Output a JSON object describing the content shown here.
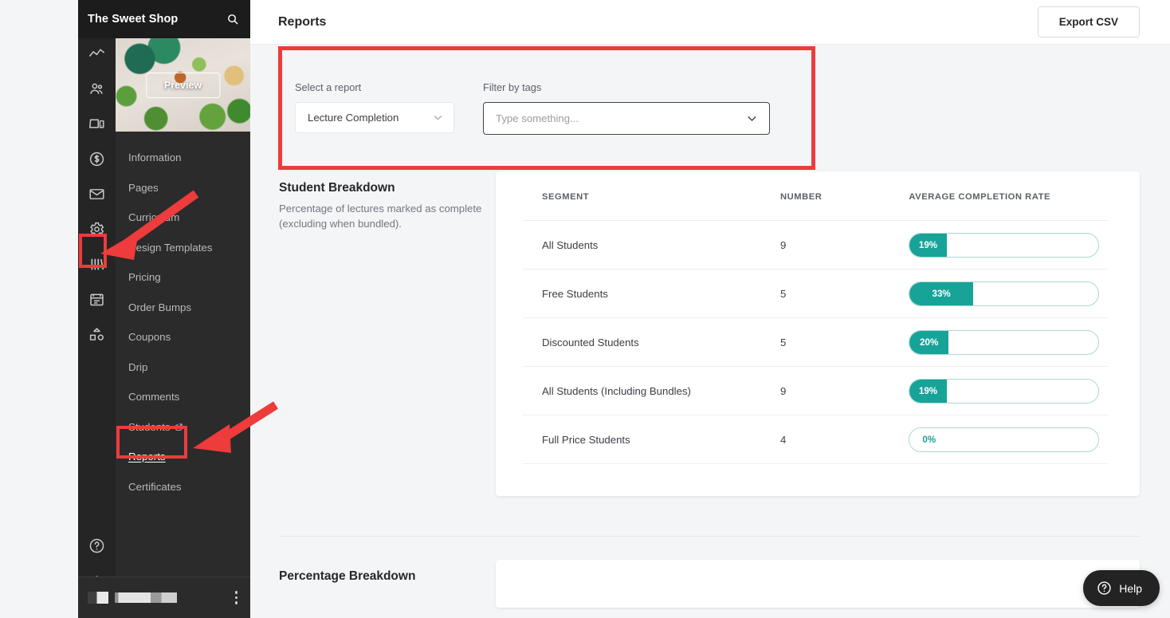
{
  "sidebar": {
    "shop_title": "The Sweet Shop",
    "search_icon": "search-icon",
    "preview_label": "Preview",
    "rail_icons": [
      {
        "name": "analytics-icon"
      },
      {
        "name": "users-icon"
      },
      {
        "name": "site-icon"
      },
      {
        "name": "payments-icon"
      },
      {
        "name": "email-icon"
      },
      {
        "name": "settings-icon"
      },
      {
        "name": "library-icon"
      },
      {
        "name": "calendar-icon"
      },
      {
        "name": "community-icon"
      }
    ],
    "rail_bottom_icons": [
      {
        "name": "help-circle-icon"
      },
      {
        "name": "affiliates-icon"
      }
    ],
    "items": [
      {
        "label": "Information",
        "active": false,
        "external": false
      },
      {
        "label": "Pages",
        "active": false,
        "external": false
      },
      {
        "label": "Curriculum",
        "active": false,
        "external": false
      },
      {
        "label": "Design Templates",
        "active": false,
        "external": false
      },
      {
        "label": "Pricing",
        "active": false,
        "external": false
      },
      {
        "label": "Order Bumps",
        "active": false,
        "external": false
      },
      {
        "label": "Coupons",
        "active": false,
        "external": false
      },
      {
        "label": "Drip",
        "active": false,
        "external": false
      },
      {
        "label": "Comments",
        "active": false,
        "external": false
      },
      {
        "label": "Students",
        "active": false,
        "external": true
      },
      {
        "label": "Reports",
        "active": true,
        "external": false
      },
      {
        "label": "Certificates",
        "active": false,
        "external": false
      }
    ]
  },
  "header": {
    "title": "Reports",
    "export_label": "Export CSV"
  },
  "filters": {
    "report_label": "Select a report",
    "report_value": "Lecture Completion",
    "tags_label": "Filter by tags",
    "tags_placeholder": "Type something...",
    "chevron_icon": "chevron-down-icon"
  },
  "student_breakdown": {
    "title": "Student Breakdown",
    "description": "Percentage of lectures marked as complete (excluding when bundled).",
    "columns": [
      "SEGMENT",
      "NUMBER",
      "AVERAGE COMPLETION RATE"
    ],
    "rows": [
      {
        "segment": "All Students",
        "number": "9",
        "rate": "19%",
        "pct": 19
      },
      {
        "segment": "Free Students",
        "number": "5",
        "rate": "33%",
        "pct": 33
      },
      {
        "segment": "Discounted Students",
        "number": "5",
        "rate": "20%",
        "pct": 20
      },
      {
        "segment": "All Students (Including Bundles)",
        "number": "9",
        "rate": "19%",
        "pct": 19
      },
      {
        "segment": "Full Price Students",
        "number": "4",
        "rate": "0%",
        "pct": 0
      }
    ]
  },
  "percentage_breakdown": {
    "title": "Percentage Breakdown"
  },
  "help": {
    "label": "Help",
    "icon": "help-circle-icon"
  },
  "colors": {
    "accent_teal": "#18a398",
    "bar_outline": "#a9d9d2",
    "annotation_red": "#ee3b3b",
    "sidebar_dark": "#2b2b2b",
    "rail_dark": "#252525"
  },
  "chart_data": {
    "type": "bar",
    "title": "Student Breakdown",
    "categories": [
      "All Students",
      "Free Students",
      "Discounted Students",
      "All Students (Including Bundles)",
      "Full Price Students"
    ],
    "values": [
      19,
      33,
      20,
      19,
      0
    ],
    "counts": [
      9,
      5,
      5,
      9,
      4
    ],
    "xlabel": "Segment",
    "ylabel": "Average Completion Rate",
    "ylim": [
      0,
      100
    ]
  }
}
